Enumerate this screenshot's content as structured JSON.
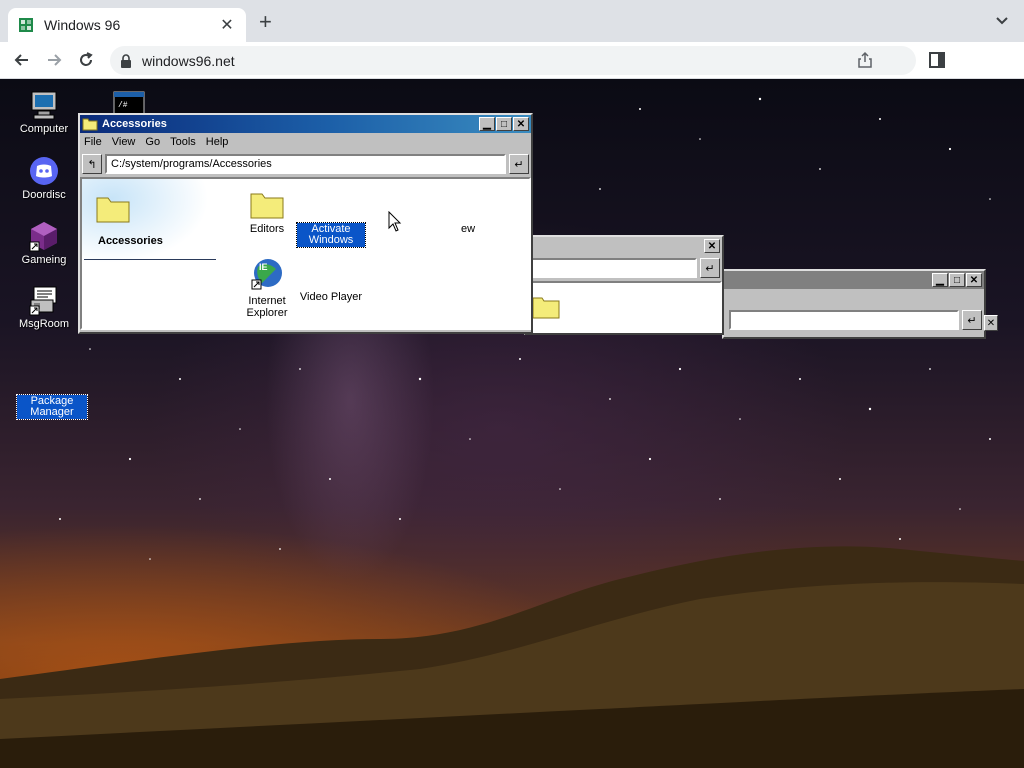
{
  "browser": {
    "tab_title": "Windows 96",
    "url": "windows96.net"
  },
  "desktop": {
    "icons": [
      {
        "label": "Computer"
      },
      {
        "label": "Doordisc"
      },
      {
        "label": "Gameing"
      },
      {
        "label": "MsgRoom"
      },
      {
        "label": "Package Manager"
      }
    ]
  },
  "explorer": {
    "title": "Accessories",
    "menu": [
      "File",
      "View",
      "Go",
      "Tools",
      "Help"
    ],
    "address": "C:/system/programs/Accessories",
    "side_title": "Accessories",
    "items": [
      {
        "label": "Editors"
      },
      {
        "label": "Activate Windows"
      },
      {
        "label": "Internet Explorer"
      },
      {
        "label": "Video Player"
      },
      {
        "label": "ew"
      }
    ]
  },
  "colors": {
    "title_active": "#1c5fa8",
    "title_inactive": "#808080",
    "selection": "#0a55c8",
    "window_face": "#c0c0c0"
  }
}
